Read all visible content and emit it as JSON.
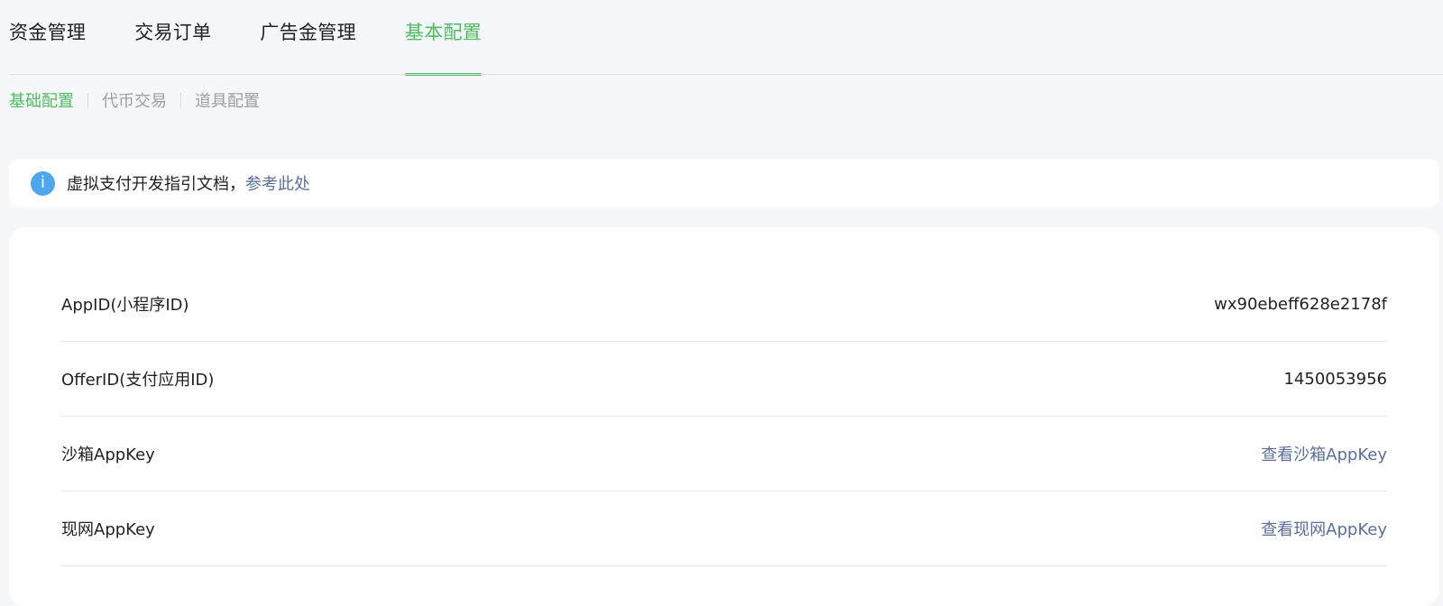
{
  "top_tabs": [
    {
      "label": "资金管理",
      "active": false
    },
    {
      "label": "交易订单",
      "active": false
    },
    {
      "label": "广告金管理",
      "active": false
    },
    {
      "label": "基本配置",
      "active": true
    }
  ],
  "sub_tabs": [
    {
      "label": "基础配置",
      "active": true
    },
    {
      "label": "代币交易",
      "active": false
    },
    {
      "label": "道具配置",
      "active": false
    }
  ],
  "notice": {
    "icon": "info-icon",
    "text": "虚拟支付开发指引文档，",
    "link": "参考此处"
  },
  "config": {
    "rows": [
      {
        "label": "AppID(小程序ID)",
        "value": "wx90ebeff628e2178f"
      },
      {
        "label": "OfferID(支付应用ID)",
        "value": "1450053956"
      },
      {
        "label": "沙箱AppKey",
        "action": "查看沙箱AppKey"
      },
      {
        "label": "现网AppKey",
        "action": "查看现网AppKey"
      }
    ]
  },
  "colors": {
    "accent": "#4fbb62",
    "link": "#5b6f98",
    "info": "#4da7ef",
    "background": "#f6f7f9"
  }
}
